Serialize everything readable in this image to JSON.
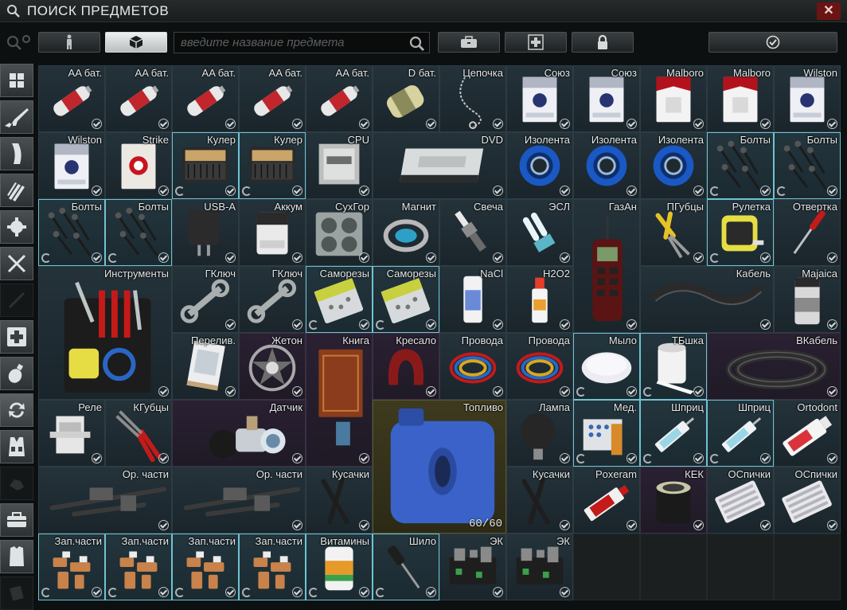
{
  "window": {
    "title": "ПОИСК ПРЕДМЕТОВ",
    "close_label": "✕"
  },
  "search": {
    "placeholder": "введите название предмета",
    "value": ""
  },
  "items": [
    {
      "name": "AA бат.",
      "col": 0,
      "row": 0,
      "w": 1,
      "h": 1,
      "icon": "battery-aa",
      "bg": "normal"
    },
    {
      "name": "AA бат.",
      "col": 1,
      "row": 0,
      "w": 1,
      "h": 1,
      "icon": "battery-aa",
      "bg": "normal"
    },
    {
      "name": "AA бат.",
      "col": 2,
      "row": 0,
      "w": 1,
      "h": 1,
      "icon": "battery-aa",
      "bg": "normal"
    },
    {
      "name": "AA бат.",
      "col": 3,
      "row": 0,
      "w": 1,
      "h": 1,
      "icon": "battery-aa",
      "bg": "normal"
    },
    {
      "name": "AA бат.",
      "col": 4,
      "row": 0,
      "w": 1,
      "h": 1,
      "icon": "battery-aa",
      "bg": "normal"
    },
    {
      "name": "D бат.",
      "col": 5,
      "row": 0,
      "w": 1,
      "h": 1,
      "icon": "battery-d",
      "bg": "normal"
    },
    {
      "name": "Цепочка",
      "col": 6,
      "row": 0,
      "w": 1,
      "h": 1,
      "icon": "chain",
      "bg": "normal"
    },
    {
      "name": "Союз",
      "col": 7,
      "row": 0,
      "w": 1,
      "h": 1,
      "icon": "cigarettes-blue",
      "bg": "normal"
    },
    {
      "name": "Союз",
      "col": 8,
      "row": 0,
      "w": 1,
      "h": 1,
      "icon": "cigarettes-blue",
      "bg": "normal"
    },
    {
      "name": "Malboro",
      "col": 9,
      "row": 0,
      "w": 1,
      "h": 1,
      "icon": "cigarettes-red",
      "bg": "normal"
    },
    {
      "name": "Malboro",
      "col": 10,
      "row": 0,
      "w": 1,
      "h": 1,
      "icon": "cigarettes-red",
      "bg": "normal"
    },
    {
      "name": "Wilston",
      "col": 11,
      "row": 0,
      "w": 1,
      "h": 1,
      "icon": "cigarettes-blue",
      "bg": "normal"
    },
    {
      "name": "Wilston",
      "col": 0,
      "row": 1,
      "w": 1,
      "h": 1,
      "icon": "cigarettes-blue",
      "bg": "normal"
    },
    {
      "name": "Strike",
      "col": 1,
      "row": 1,
      "w": 1,
      "h": 1,
      "icon": "cigarettes-strike",
      "bg": "normal"
    },
    {
      "name": "Кулер",
      "col": 2,
      "row": 1,
      "w": 1,
      "h": 1,
      "icon": "cooler",
      "bg": "cyan",
      "rot": true
    },
    {
      "name": "Кулер",
      "col": 3,
      "row": 1,
      "w": 1,
      "h": 1,
      "icon": "cooler",
      "bg": "cyan",
      "rot": true
    },
    {
      "name": "CPU",
      "col": 4,
      "row": 1,
      "w": 1,
      "h": 1,
      "icon": "cpu",
      "bg": "normal"
    },
    {
      "name": "DVD",
      "col": 5,
      "row": 1,
      "w": 2,
      "h": 1,
      "icon": "dvd",
      "bg": "normal"
    },
    {
      "name": "Изолента",
      "col": 7,
      "row": 1,
      "w": 1,
      "h": 1,
      "icon": "tape",
      "bg": "normal"
    },
    {
      "name": "Изолента",
      "col": 8,
      "row": 1,
      "w": 1,
      "h": 1,
      "icon": "tape",
      "bg": "normal"
    },
    {
      "name": "Изолента",
      "col": 9,
      "row": 1,
      "w": 1,
      "h": 1,
      "icon": "tape",
      "bg": "normal"
    },
    {
      "name": "Болты",
      "col": 10,
      "row": 1,
      "w": 1,
      "h": 1,
      "icon": "bolts",
      "bg": "cyan",
      "rot": true
    },
    {
      "name": "Болты",
      "col": 11,
      "row": 1,
      "w": 1,
      "h": 1,
      "icon": "bolts",
      "bg": "cyan",
      "rot": true
    },
    {
      "name": "Болты",
      "col": 0,
      "row": 2,
      "w": 1,
      "h": 1,
      "icon": "bolts",
      "bg": "cyan",
      "rot": true
    },
    {
      "name": "Болты",
      "col": 1,
      "row": 2,
      "w": 1,
      "h": 1,
      "icon": "bolts",
      "bg": "cyan",
      "rot": true
    },
    {
      "name": "USB-A",
      "col": 2,
      "row": 2,
      "w": 1,
      "h": 1,
      "icon": "charger",
      "bg": "normal"
    },
    {
      "name": "Аккум",
      "col": 3,
      "row": 2,
      "w": 1,
      "h": 1,
      "icon": "battery-pack",
      "bg": "normal"
    },
    {
      "name": "СухГор",
      "col": 4,
      "row": 2,
      "w": 1,
      "h": 1,
      "icon": "dry-fuel",
      "bg": "normal"
    },
    {
      "name": "Магнит",
      "col": 5,
      "row": 2,
      "w": 1,
      "h": 1,
      "icon": "magnet",
      "bg": "normal"
    },
    {
      "name": "Свеча",
      "col": 6,
      "row": 2,
      "w": 1,
      "h": 1,
      "icon": "spark-plug",
      "bg": "normal"
    },
    {
      "name": "ЭСЛ",
      "col": 7,
      "row": 2,
      "w": 1,
      "h": 1,
      "icon": "cfl-bulb",
      "bg": "normal"
    },
    {
      "name": "ГазАн",
      "col": 8,
      "row": 2,
      "w": 1,
      "h": 2,
      "icon": "gas-analyzer",
      "bg": "normal"
    },
    {
      "name": "ПГубцы",
      "col": 9,
      "row": 2,
      "w": 1,
      "h": 1,
      "icon": "pliers",
      "bg": "normal"
    },
    {
      "name": "Рулетка",
      "col": 10,
      "row": 2,
      "w": 1,
      "h": 1,
      "icon": "tape-measure",
      "bg": "cyan",
      "rot": true
    },
    {
      "name": "Отвертка",
      "col": 11,
      "row": 2,
      "w": 1,
      "h": 1,
      "icon": "screwdriver",
      "bg": "normal"
    },
    {
      "name": "Инструменты",
      "col": 0,
      "row": 3,
      "w": 2,
      "h": 2,
      "icon": "toolset",
      "bg": "normal"
    },
    {
      "name": "ГКлюч",
      "col": 2,
      "row": 3,
      "w": 1,
      "h": 1,
      "icon": "wrench",
      "bg": "normal"
    },
    {
      "name": "ГКлюч",
      "col": 3,
      "row": 3,
      "w": 1,
      "h": 1,
      "icon": "wrench",
      "bg": "normal"
    },
    {
      "name": "Саморезы",
      "col": 4,
      "row": 3,
      "w": 1,
      "h": 1,
      "icon": "screws",
      "bg": "cyan",
      "rot": true
    },
    {
      "name": "Саморезы",
      "col": 5,
      "row": 3,
      "w": 1,
      "h": 1,
      "icon": "screws",
      "bg": "cyan",
      "rot": true
    },
    {
      "name": "NaCl",
      "col": 6,
      "row": 3,
      "w": 1,
      "h": 1,
      "icon": "saline",
      "bg": "normal"
    },
    {
      "name": "H2O2",
      "col": 7,
      "row": 3,
      "w": 1,
      "h": 1,
      "icon": "bottle",
      "bg": "normal"
    },
    {
      "name": "Кабель",
      "col": 9,
      "row": 3,
      "w": 2,
      "h": 1,
      "icon": "cable",
      "bg": "normal"
    },
    {
      "name": "Majaica",
      "col": 11,
      "row": 3,
      "w": 1,
      "h": 1,
      "icon": "can",
      "bg": "normal"
    },
    {
      "name": "Перелив.",
      "col": 2,
      "row": 4,
      "w": 1,
      "h": 1,
      "icon": "bag",
      "bg": "normal"
    },
    {
      "name": "Жетон",
      "col": 3,
      "row": 4,
      "w": 1,
      "h": 1,
      "icon": "token",
      "bg": "purple"
    },
    {
      "name": "Книга",
      "col": 4,
      "row": 4,
      "w": 1,
      "h": 2,
      "icon": "book",
      "bg": "purple"
    },
    {
      "name": "Кресало",
      "col": 5,
      "row": 4,
      "w": 1,
      "h": 1,
      "icon": "flint",
      "bg": "purple"
    },
    {
      "name": "Провода",
      "col": 6,
      "row": 4,
      "w": 1,
      "h": 1,
      "icon": "wires",
      "bg": "normal"
    },
    {
      "name": "Провода",
      "col": 7,
      "row": 4,
      "w": 1,
      "h": 1,
      "icon": "wires",
      "bg": "normal"
    },
    {
      "name": "Мыло",
      "col": 8,
      "row": 4,
      "w": 1,
      "h": 1,
      "icon": "soap",
      "bg": "cyan",
      "rot": true
    },
    {
      "name": "ТБшка",
      "col": 9,
      "row": 4,
      "w": 1,
      "h": 1,
      "icon": "toilet-paper",
      "bg": "cyan",
      "rot": true
    },
    {
      "name": "ВКабель",
      "col": 10,
      "row": 4,
      "w": 2,
      "h": 1,
      "icon": "cable-coil",
      "bg": "purple"
    },
    {
      "name": "Реле",
      "col": 0,
      "row": 5,
      "w": 1,
      "h": 1,
      "icon": "relay",
      "bg": "normal"
    },
    {
      "name": "КГубцы",
      "col": 1,
      "row": 5,
      "w": 1,
      "h": 1,
      "icon": "pliers-red",
      "bg": "normal"
    },
    {
      "name": "Датчик",
      "col": 2,
      "row": 5,
      "w": 2,
      "h": 1,
      "icon": "sensor",
      "bg": "purple"
    },
    {
      "name": "Топливо",
      "col": 5,
      "row": 5,
      "w": 2,
      "h": 2,
      "icon": "jerrycan",
      "bg": "yellow",
      "count": "60/60"
    },
    {
      "name": "Лампа",
      "col": 7,
      "row": 5,
      "w": 1,
      "h": 1,
      "icon": "lamp",
      "bg": "normal"
    },
    {
      "name": "Мед.",
      "col": 8,
      "row": 5,
      "w": 1,
      "h": 1,
      "icon": "meds",
      "bg": "cyan",
      "rot": true
    },
    {
      "name": "Шприц",
      "col": 9,
      "row": 5,
      "w": 1,
      "h": 1,
      "icon": "syringe",
      "bg": "cyan",
      "rot": true
    },
    {
      "name": "Шприц",
      "col": 10,
      "row": 5,
      "w": 1,
      "h": 1,
      "icon": "syringe",
      "bg": "cyan",
      "rot": true
    },
    {
      "name": "Ortodont",
      "col": 11,
      "row": 5,
      "w": 1,
      "h": 1,
      "icon": "toothpaste",
      "bg": "normal"
    },
    {
      "name": "Ор. части",
      "col": 0,
      "row": 6,
      "w": 2,
      "h": 1,
      "icon": "gun-parts",
      "bg": "normal"
    },
    {
      "name": "Ор. части",
      "col": 2,
      "row": 6,
      "w": 2,
      "h": 1,
      "icon": "gun-parts",
      "bg": "normal"
    },
    {
      "name": "Кусачки",
      "col": 4,
      "row": 6,
      "w": 1,
      "h": 1,
      "icon": "cutters",
      "bg": "normal"
    },
    {
      "name": "Кусачки",
      "col": 7,
      "row": 6,
      "w": 1,
      "h": 1,
      "icon": "cutters",
      "bg": "normal"
    },
    {
      "name": "Poxeram",
      "col": 8,
      "row": 6,
      "w": 1,
      "h": 1,
      "icon": "glue-tube",
      "bg": "normal"
    },
    {
      "name": "КЕК",
      "col": 9,
      "row": 6,
      "w": 1,
      "h": 1,
      "icon": "filter",
      "bg": "purple"
    },
    {
      "name": "ОСпички",
      "col": 10,
      "row": 6,
      "w": 1,
      "h": 1,
      "icon": "matches",
      "bg": "normal"
    },
    {
      "name": "ОСпички",
      "col": 11,
      "row": 6,
      "w": 1,
      "h": 1,
      "icon": "matches",
      "bg": "normal"
    },
    {
      "name": "Зап.части",
      "col": 0,
      "row": 7,
      "w": 1,
      "h": 1,
      "icon": "fittings",
      "bg": "cyan",
      "rot": true
    },
    {
      "name": "Зап.части",
      "col": 1,
      "row": 7,
      "w": 1,
      "h": 1,
      "icon": "fittings",
      "bg": "cyan",
      "rot": true
    },
    {
      "name": "Зап.части",
      "col": 2,
      "row": 7,
      "w": 1,
      "h": 1,
      "icon": "fittings",
      "bg": "cyan",
      "rot": true
    },
    {
      "name": "Зап.части",
      "col": 3,
      "row": 7,
      "w": 1,
      "h": 1,
      "icon": "fittings",
      "bg": "cyan",
      "rot": true
    },
    {
      "name": "Витамины",
      "col": 4,
      "row": 7,
      "w": 1,
      "h": 1,
      "icon": "vitamins",
      "bg": "cyan",
      "rot": true
    },
    {
      "name": "Шило",
      "col": 5,
      "row": 7,
      "w": 1,
      "h": 1,
      "icon": "awl",
      "bg": "cyan",
      "rot": true
    },
    {
      "name": "ЭК",
      "col": 6,
      "row": 7,
      "w": 1,
      "h": 1,
      "icon": "circuit",
      "bg": "normal"
    },
    {
      "name": "ЭК",
      "col": 7,
      "row": 7,
      "w": 1,
      "h": 1,
      "icon": "circuit",
      "bg": "normal"
    }
  ],
  "colors": {
    "accent": "#6fc3d3",
    "close": "#6b1414",
    "rare": "#2a2032",
    "fuel": "#3d3a1e"
  }
}
